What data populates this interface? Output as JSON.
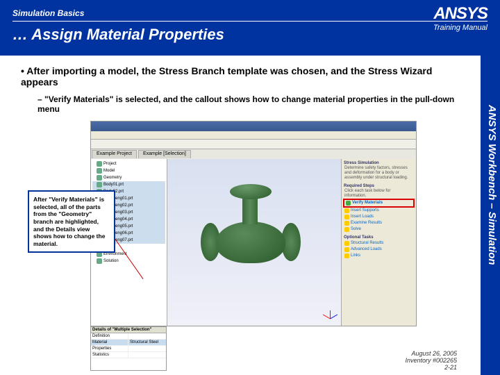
{
  "header": {
    "course": "Simulation Basics",
    "title": "… Assign Material Properties",
    "brand": "ANSYS",
    "sub": "Training Manual"
  },
  "sidebar": "ANSYS Workbench – Simulation",
  "bullets": {
    "b1": "After importing a model, the Stress Branch template was chosen, and the Stress Wizard appears",
    "b2": "\"Verify Materials\" is selected, and the callout shows how to change material properties in the pull-down menu"
  },
  "callout": "After \"Verify Materials\" is selected, all of the parts from the \"Geometry\" branch are highlighted, and the Details view shows how to change the material.",
  "app": {
    "tabs": [
      "Example Project",
      "Example [Selection]"
    ],
    "tree": [
      {
        "t": "Project"
      },
      {
        "t": "Model"
      },
      {
        "t": "Geometry"
      },
      {
        "t": "Body01.prt",
        "hl": true
      },
      {
        "t": "Body02.prt",
        "hl": true
      },
      {
        "t": "Body_eng01.prt",
        "hl": true
      },
      {
        "t": "Body_eng02.prt",
        "hl": true
      },
      {
        "t": "Body_eng03.prt",
        "hl": true
      },
      {
        "t": "Body_eng04.prt",
        "hl": true
      },
      {
        "t": "Body_eng05.prt",
        "hl": true
      },
      {
        "t": "Body_eng06.prt",
        "hl": true
      },
      {
        "t": "Body_eng07.prt",
        "hl": true
      },
      {
        "t": "Mesh"
      },
      {
        "t": "Environment"
      },
      {
        "t": "Solution"
      }
    ],
    "wizard": {
      "header": "Stress Simulation",
      "intro": "Determine safety factors, stresses and deformation for a body or assembly under structural loading.",
      "required_label": "Required Steps",
      "required_instr": "Click each task below for information.",
      "items_req": [
        {
          "t": "Verify Materials",
          "hl": true
        },
        {
          "t": "Insert Supports"
        },
        {
          "t": "Insert Loads"
        },
        {
          "t": "Examine Results"
        },
        {
          "t": "Solve"
        }
      ],
      "optional_label": "Optional Tasks",
      "items_opt": [
        {
          "t": "Structural Results"
        },
        {
          "t": "Advanced Loads"
        },
        {
          "t": "Links"
        }
      ]
    },
    "details": {
      "title": "Details of \"Multiple Selection\"",
      "rows": [
        {
          "k": "Definition",
          "v": ""
        },
        {
          "k": "Material",
          "v": "Structural Steel",
          "sel": true
        },
        {
          "k": "Properties",
          "v": ""
        },
        {
          "k": "Statistics",
          "v": ""
        }
      ]
    }
  },
  "footer": {
    "date": "August 26, 2005",
    "inv": "Inventory #002265",
    "page": "2-21"
  }
}
